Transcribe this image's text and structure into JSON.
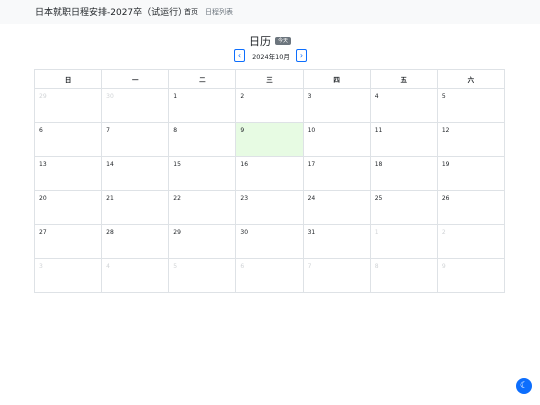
{
  "navbar": {
    "brand": "日本就职日程安排-2027卒（试运行）",
    "links": [
      {
        "label": "首页"
      },
      {
        "label": "日程列表"
      }
    ]
  },
  "calendar": {
    "title": "日历",
    "today_badge": "今天",
    "month_label": "2024年10月",
    "prev_icon": "chevron-left-icon",
    "next_icon": "chevron-right-icon",
    "weekdays": [
      "日",
      "一",
      "二",
      "三",
      "四",
      "五",
      "六"
    ],
    "today_day": "9",
    "weeks": [
      [
        {
          "day": "29",
          "other": true
        },
        {
          "day": "30",
          "other": true
        },
        {
          "day": "1",
          "other": false
        },
        {
          "day": "2",
          "other": false
        },
        {
          "day": "3",
          "other": false
        },
        {
          "day": "4",
          "other": false
        },
        {
          "day": "5",
          "other": false
        }
      ],
      [
        {
          "day": "6",
          "other": false
        },
        {
          "day": "7",
          "other": false
        },
        {
          "day": "8",
          "other": false
        },
        {
          "day": "9",
          "other": false
        },
        {
          "day": "10",
          "other": false
        },
        {
          "day": "11",
          "other": false
        },
        {
          "day": "12",
          "other": false
        }
      ],
      [
        {
          "day": "13",
          "other": false
        },
        {
          "day": "14",
          "other": false
        },
        {
          "day": "15",
          "other": false
        },
        {
          "day": "16",
          "other": false
        },
        {
          "day": "17",
          "other": false
        },
        {
          "day": "18",
          "other": false
        },
        {
          "day": "19",
          "other": false
        }
      ],
      [
        {
          "day": "20",
          "other": false
        },
        {
          "day": "21",
          "other": false
        },
        {
          "day": "22",
          "other": false
        },
        {
          "day": "23",
          "other": false
        },
        {
          "day": "24",
          "other": false
        },
        {
          "day": "25",
          "other": false
        },
        {
          "day": "26",
          "other": false
        }
      ],
      [
        {
          "day": "27",
          "other": false
        },
        {
          "day": "28",
          "other": false
        },
        {
          "day": "29",
          "other": false
        },
        {
          "day": "30",
          "other": false
        },
        {
          "day": "31",
          "other": false
        },
        {
          "day": "1",
          "other": true
        },
        {
          "day": "2",
          "other": true
        }
      ],
      [
        {
          "day": "3",
          "other": true
        },
        {
          "day": "4",
          "other": true
        },
        {
          "day": "5",
          "other": true
        },
        {
          "day": "6",
          "other": true
        },
        {
          "day": "7",
          "other": true
        },
        {
          "day": "8",
          "other": true
        },
        {
          "day": "9",
          "other": true
        }
      ]
    ]
  },
  "theme_toggle": {
    "icon": "moon-icon"
  },
  "colors": {
    "accent": "#0d6efd",
    "today_bg": "#e7fbe3",
    "badge": "#6c757d",
    "navbar_bg": "#f8f9fa"
  }
}
